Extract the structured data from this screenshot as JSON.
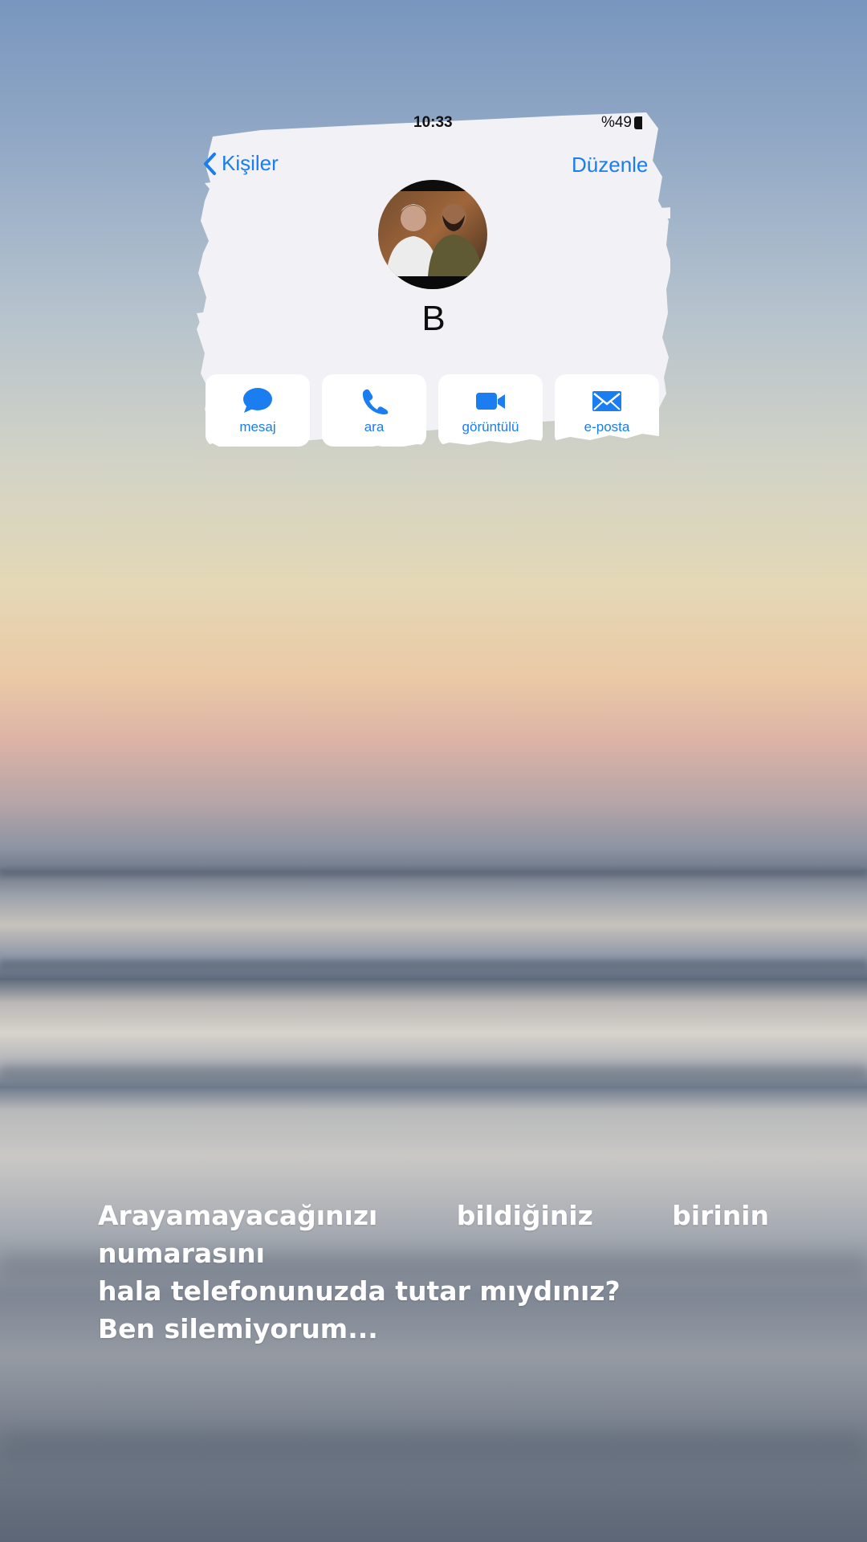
{
  "status_bar": {
    "time": "10:33",
    "battery": "%49"
  },
  "navigation": {
    "back_label": "Kişiler",
    "edit_label": "Düzenle"
  },
  "contact": {
    "name": "B"
  },
  "actions": [
    {
      "label": "mesaj",
      "icon": "message-bubble-icon"
    },
    {
      "label": "ara",
      "icon": "phone-icon"
    },
    {
      "label": "görüntülü",
      "icon": "video-camera-icon"
    },
    {
      "label": "e-posta",
      "icon": "envelope-icon"
    }
  ],
  "caption": {
    "line1": "Arayamayacağınızı bildiğiniz birinin numarasını",
    "line2": "hala telefonunuzda tutar mıydınız?",
    "line3": "Ben silemiyorum..."
  },
  "colors": {
    "accent": "#1a7df0",
    "card": "#f2f2f6",
    "caption_text": "#ffffff"
  }
}
